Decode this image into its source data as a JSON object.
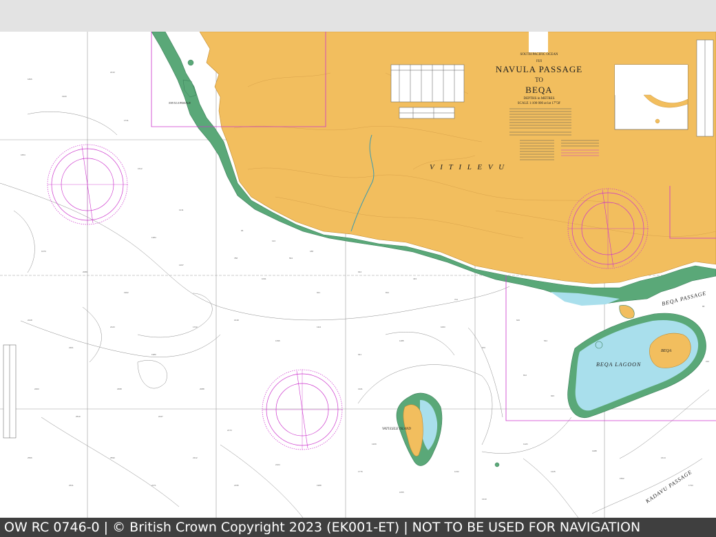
{
  "chart_header": {
    "region": "SOUTH PACIFIC OCEAN",
    "country": "FIJI",
    "title_line1": "NAVULA PASSAGE",
    "title_line2": "TO",
    "title_line3": "BEQA",
    "depths": "DEPTHS in METRES",
    "scale": "SCALE 1:100 000 at lat 17°58'"
  },
  "labels": {
    "viti_levu": "V I T I   L E V U",
    "beqa_lagoon": "BEQA LAGOON",
    "beqa_passage": "BEQA PASSAGE",
    "kadavu_passage": "KADAVU PASSAGE",
    "vatulele_island": "VATULELE ISLAND",
    "beqa": "BEQA",
    "navula_passage": "NAVULA PASSAGE"
  },
  "footer": {
    "text": "OW RC 0746-0 | © British Crown Copyright 2023 (EK001-ET) | NOT TO BE USED FOR NAVIGATION"
  },
  "colors": {
    "land": "#f2be5e",
    "drying": "#5aa878",
    "shallow": "#a9dfec",
    "sea": "#ffffff",
    "magenta": "#cc33cc"
  }
}
